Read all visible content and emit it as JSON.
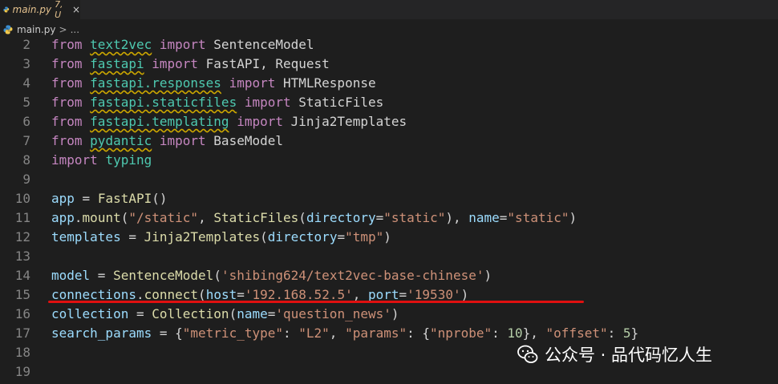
{
  "tab": {
    "filename": "main.py",
    "status": "7, U",
    "close_glyph": "×"
  },
  "breadcrumb": {
    "file": "main.py",
    "sep": ">",
    "more": "..."
  },
  "lines": [
    {
      "n": "2",
      "tokens": [
        [
          "kw",
          "from "
        ],
        [
          "mod squig",
          "text2vec"
        ],
        [
          "kw",
          " import "
        ],
        [
          "op",
          "SentenceModel"
        ]
      ]
    },
    {
      "n": "3",
      "tokens": [
        [
          "kw",
          "from "
        ],
        [
          "mod squig",
          "fastapi"
        ],
        [
          "kw",
          " import "
        ],
        [
          "op",
          "FastAPI, Request"
        ]
      ]
    },
    {
      "n": "4",
      "tokens": [
        [
          "kw",
          "from "
        ],
        [
          "mod squig",
          "fastapi.responses"
        ],
        [
          "kw",
          " import "
        ],
        [
          "op",
          "HTMLResponse"
        ]
      ]
    },
    {
      "n": "5",
      "tokens": [
        [
          "kw",
          "from "
        ],
        [
          "mod squig",
          "fastapi.staticfiles"
        ],
        [
          "kw",
          " import "
        ],
        [
          "op",
          "StaticFiles"
        ]
      ]
    },
    {
      "n": "6",
      "tokens": [
        [
          "kw",
          "from "
        ],
        [
          "mod squig",
          "fastapi.templating"
        ],
        [
          "kw",
          " import "
        ],
        [
          "op",
          "Jinja2Templates"
        ]
      ]
    },
    {
      "n": "7",
      "tokens": [
        [
          "kw",
          "from "
        ],
        [
          "mod squig",
          "pydantic"
        ],
        [
          "kw",
          " import "
        ],
        [
          "op",
          "BaseModel"
        ]
      ]
    },
    {
      "n": "8",
      "tokens": [
        [
          "kw",
          "import "
        ],
        [
          "mod",
          "typing"
        ]
      ]
    },
    {
      "n": "9",
      "tokens": []
    },
    {
      "n": "10",
      "tokens": [
        [
          "var",
          "app"
        ],
        [
          "op",
          " = "
        ],
        [
          "fn",
          "FastAPI"
        ],
        [
          "op",
          "()"
        ]
      ]
    },
    {
      "n": "11",
      "tokens": [
        [
          "var",
          "app"
        ],
        [
          "op",
          "."
        ],
        [
          "fn",
          "mount"
        ],
        [
          "op",
          "("
        ],
        [
          "str",
          "\"/static\""
        ],
        [
          "op",
          ", "
        ],
        [
          "fn",
          "StaticFiles"
        ],
        [
          "op",
          "("
        ],
        [
          "var",
          "directory"
        ],
        [
          "op",
          "="
        ],
        [
          "str",
          "\"static\""
        ],
        [
          "op",
          "), "
        ],
        [
          "var",
          "name"
        ],
        [
          "op",
          "="
        ],
        [
          "str",
          "\"static\""
        ],
        [
          "op",
          ")"
        ]
      ]
    },
    {
      "n": "12",
      "tokens": [
        [
          "var",
          "templates"
        ],
        [
          "op",
          " = "
        ],
        [
          "fn",
          "Jinja2Templates"
        ],
        [
          "op",
          "("
        ],
        [
          "var",
          "directory"
        ],
        [
          "op",
          "="
        ],
        [
          "str",
          "\"tmp\""
        ],
        [
          "op",
          ")"
        ]
      ]
    },
    {
      "n": "13",
      "tokens": []
    },
    {
      "n": "14",
      "tokens": [
        [
          "var",
          "model"
        ],
        [
          "op",
          " = "
        ],
        [
          "fn",
          "SentenceModel"
        ],
        [
          "op",
          "("
        ],
        [
          "str",
          "'shibing624/text2vec-base-chinese'"
        ],
        [
          "op",
          ")"
        ]
      ]
    },
    {
      "n": "15",
      "tokens": [
        [
          "var",
          "connections"
        ],
        [
          "op",
          "."
        ],
        [
          "fn",
          "connect"
        ],
        [
          "op",
          "("
        ],
        [
          "var",
          "host"
        ],
        [
          "op",
          "="
        ],
        [
          "str",
          "'192.168.52.5'"
        ],
        [
          "op",
          ", "
        ],
        [
          "var",
          "port"
        ],
        [
          "op",
          "="
        ],
        [
          "str",
          "'19530'"
        ],
        [
          "op",
          ")"
        ]
      ]
    },
    {
      "n": "16",
      "tokens": [
        [
          "var",
          "collection"
        ],
        [
          "op",
          " = "
        ],
        [
          "fn",
          "Collection"
        ],
        [
          "op",
          "("
        ],
        [
          "var",
          "name"
        ],
        [
          "op",
          "="
        ],
        [
          "str",
          "'question_news'"
        ],
        [
          "op",
          ")"
        ]
      ]
    },
    {
      "n": "17",
      "tokens": [
        [
          "var",
          "search_params"
        ],
        [
          "op",
          " = {"
        ],
        [
          "str",
          "\"metric_type\""
        ],
        [
          "op",
          ": "
        ],
        [
          "str",
          "\"L2\""
        ],
        [
          "op",
          ", "
        ],
        [
          "str",
          "\"params\""
        ],
        [
          "op",
          ": {"
        ],
        [
          "str",
          "\"nprobe\""
        ],
        [
          "op",
          ": "
        ],
        [
          "num",
          "10"
        ],
        [
          "op",
          "}, "
        ],
        [
          "str",
          "\"offset\""
        ],
        [
          "op",
          ": "
        ],
        [
          "num",
          "5"
        ],
        [
          "op",
          "}"
        ]
      ]
    },
    {
      "n": "18",
      "tokens": []
    },
    {
      "n": "19",
      "tokens": []
    }
  ],
  "watermark": {
    "text": "公众号 · 品代码忆人生",
    "icon": "wechat-icon"
  },
  "colors": {
    "background": "#1e1e1e",
    "keyword": "#c586c0",
    "module": "#4ec9b0",
    "function": "#dcdcaa",
    "variable": "#9cdcfe",
    "string": "#ce9178",
    "number": "#b5cea8",
    "annotation": "#e01010"
  }
}
